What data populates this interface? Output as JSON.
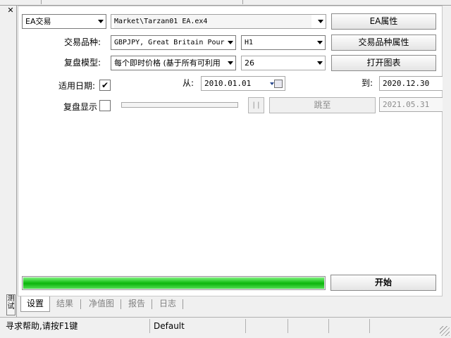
{
  "expert": {
    "selector_label": "EA交易",
    "path": "Market\\Tarzan01 EA.ex4",
    "props_button": "EA属性"
  },
  "symbol": {
    "label": "交易品种:",
    "value": "GBPJPY, Great Britain Pour",
    "period": "H1",
    "props_button": "交易品种属性"
  },
  "model": {
    "label": "复盘模型:",
    "value": "每个即时价格 (基于所有可利用",
    "spread": "26",
    "chart_button": "打开图表"
  },
  "dates": {
    "label": "适用日期:",
    "checked": "✔",
    "from_label": "从:",
    "from": "2010.01.01",
    "to_label": "到:",
    "to": "2020.12.30"
  },
  "visual": {
    "label": "复盘显示",
    "pause": "| |",
    "skip_button": "跳至",
    "skip_date": "2021.05.31"
  },
  "progress": {
    "percent": 100
  },
  "start_button": "开始",
  "tabs": [
    "设置",
    "结果",
    "净值图",
    "报告",
    "日志"
  ],
  "side_tab": "测试",
  "status": {
    "help": "寻求帮助,请按F1键",
    "profile": "Default"
  }
}
